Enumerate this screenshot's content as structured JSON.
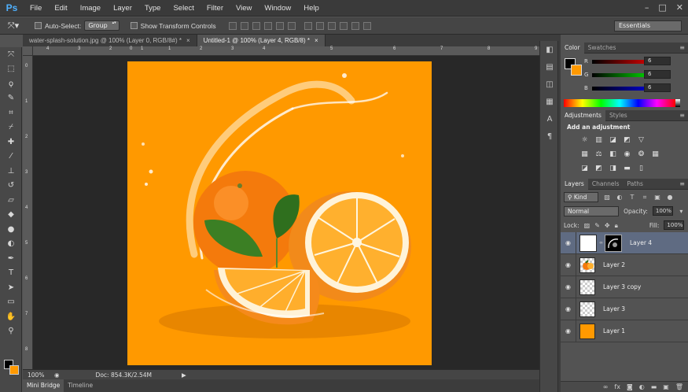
{
  "app": {
    "logo": "Ps"
  },
  "menu": [
    "File",
    "Edit",
    "Image",
    "Layer",
    "Type",
    "Select",
    "Filter",
    "View",
    "Window",
    "Help"
  ],
  "window_controls": [
    "–",
    "□",
    "✕"
  ],
  "options_bar": {
    "auto_select_label": "Auto-Select:",
    "auto_select_value": "Group",
    "transform_label": "Show Transform Controls",
    "workspace": "Essentials"
  },
  "document_tabs": [
    {
      "label": "water-splash-solution.jpg @ 100% (Layer 0, RGB/8#) *",
      "close": "×"
    },
    {
      "label": "Untitled-1 @ 100% (Layer 4, RGB/8) *",
      "close": "×"
    }
  ],
  "rulers": {
    "top": [
      "4",
      "3",
      "2",
      "1",
      "0",
      "1",
      "2",
      "3",
      "4",
      "5",
      "6",
      "7",
      "8",
      "9"
    ],
    "left": [
      "0",
      "1",
      "2",
      "3",
      "4",
      "5",
      "6",
      "7",
      "8"
    ]
  },
  "status": {
    "zoom": "100%",
    "doc": "Doc: 854.3K/2.54M"
  },
  "bottom_tabs": [
    "Mini Bridge",
    "Timeline"
  ],
  "color_panel": {
    "tabs": [
      "Color",
      "Swatches"
    ],
    "channels": [
      {
        "label": "R",
        "value": "6"
      },
      {
        "label": "G",
        "value": "6"
      },
      {
        "label": "B",
        "value": "6"
      }
    ],
    "fg_color": "#000000",
    "bg_color": "#ff9900"
  },
  "adjustments_panel": {
    "tabs": [
      "Adjustments",
      "Styles"
    ],
    "title": "Add an adjustment"
  },
  "layers_panel": {
    "tabs": [
      "Layers",
      "Channels",
      "Paths"
    ],
    "kind_filter": "Kind",
    "blend_mode": "Normal",
    "opacity_label": "Opacity:",
    "opacity": "100%",
    "lock_label": "Lock:",
    "fill_label": "Fill:",
    "fill": "100%",
    "layers": [
      {
        "name": "Layer 4",
        "thumb": "white",
        "selected": true,
        "mask": true
      },
      {
        "name": "Layer 2",
        "thumb": "orange-image",
        "selected": false
      },
      {
        "name": "Layer 3 copy",
        "thumb": "transparent",
        "selected": false
      },
      {
        "name": "Layer 3",
        "thumb": "transparent",
        "selected": false
      },
      {
        "name": "Layer 1",
        "thumb": "orange-fill",
        "selected": false
      }
    ],
    "footer_icons": [
      "link-icon",
      "fx-icon",
      "mask-icon",
      "adjustment-icon",
      "folder-icon",
      "new-layer-icon",
      "trash-icon"
    ]
  },
  "colors": {
    "canvas_bg": "#ff9900",
    "ps_blue": "#4fb1ff",
    "selected_layer": "#5f6b82"
  }
}
